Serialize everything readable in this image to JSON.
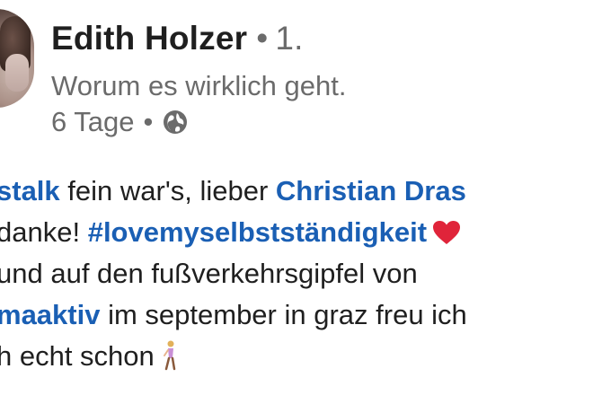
{
  "post": {
    "author": {
      "name": "Edith Holzer",
      "separator": "•",
      "connection_degree": "1.",
      "headline": "Worum es wirklich geht.",
      "time_ago": "6 Tage",
      "visibility_icon": "globe-icon"
    },
    "body": {
      "line1": {
        "link1": "stalk",
        "text": " fein war's, lieber ",
        "link2": "Christian Dras"
      },
      "line2": {
        "text": " danke! ",
        "hashtag": "#lovemyselbstständigkeit",
        "emoji": "heart-icon"
      },
      "line3": {
        "text": " und auf den fußverkehrsgipfel von"
      },
      "line4": {
        "link": "maaktiv",
        "text": " im september in graz freu ich"
      },
      "line5": {
        "text": "h echt schon",
        "emoji": "person-walking-icon"
      }
    }
  },
  "colors": {
    "link": "#1a5fb4",
    "text": "#1f1f1f",
    "muted": "#6b6b6b",
    "heart": "#e0243a"
  }
}
